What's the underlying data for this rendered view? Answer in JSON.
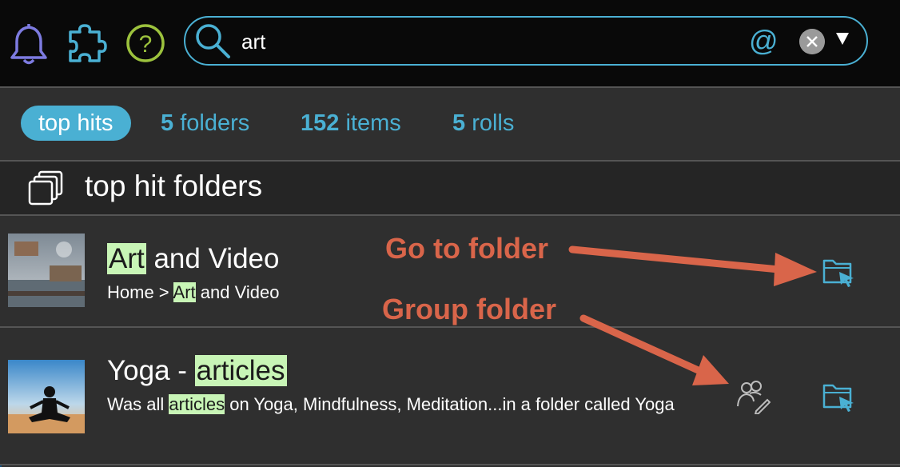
{
  "header": {
    "icons": [
      "bell-icon",
      "puzzle-icon",
      "help-icon"
    ],
    "search": {
      "value": "art",
      "at_symbol": "@",
      "icons": [
        "search-icon",
        "clear-icon",
        "dropdown-arrow-icon"
      ]
    }
  },
  "filters": {
    "tabs": [
      {
        "label": "top hits"
      },
      {
        "count": "5",
        "label": "folders"
      },
      {
        "count": "152",
        "label": "items"
      },
      {
        "count": "5",
        "label": "rolls"
      }
    ]
  },
  "section": {
    "title": "top hit folders",
    "icon": "folders-stack-icon"
  },
  "results": [
    {
      "title_highlight": "Art",
      "title_rest": " and Video",
      "path_prefix": "Home > ",
      "path_highlight": "Art",
      "path_rest": " and Video",
      "actions": [
        "go-to-folder-icon"
      ]
    },
    {
      "title_prefix": "Yoga - ",
      "title_highlight": "articles",
      "desc_prefix": "Was all ",
      "desc_highlight": "articles",
      "desc_rest": " on Yoga, Mindfulness, Meditation...in a folder called Yoga",
      "actions": [
        "group-folder-icon",
        "go-to-folder-icon"
      ]
    }
  ],
  "annotations": {
    "go_to_folder": "Go to folder",
    "group_folder": "Group folder"
  },
  "colors": {
    "accent": "#4ab0d3",
    "highlight": "#c8f5b6",
    "annotation": "#d9654a",
    "bell": "#7d7be0",
    "help": "#9cc23d"
  }
}
